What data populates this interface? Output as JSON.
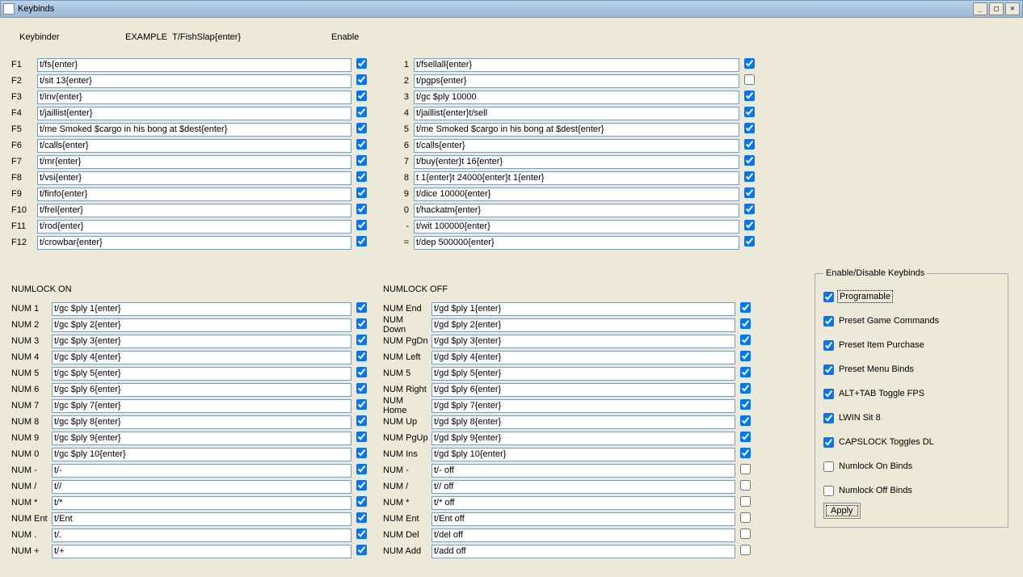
{
  "window": {
    "title": "Keybinds",
    "minimize": "_",
    "maximize": "□",
    "close": "✕"
  },
  "headers": {
    "keybinder": "Keybinder",
    "example_pre": "EXAMPLE",
    "example_txt": "T/FishSlap{enter}",
    "enable": "Enable"
  },
  "fkeys": [
    {
      "k": "F1",
      "v": "t/fs{enter}",
      "c": true
    },
    {
      "k": "F2",
      "v": "t/sit 13{enter}",
      "c": true
    },
    {
      "k": "F3",
      "v": "t/inv{enter}",
      "c": true
    },
    {
      "k": "F4",
      "v": "t/jaillist{enter}",
      "c": true
    },
    {
      "k": "F5",
      "v": "t/me Smoked $cargo in his bong at $dest{enter}",
      "c": true
    },
    {
      "k": "F6",
      "v": "t/calls{enter}",
      "c": true
    },
    {
      "k": "F7",
      "v": "t/mr{enter}",
      "c": true
    },
    {
      "k": "F8",
      "v": "t/vsi{enter}",
      "c": true
    },
    {
      "k": "F9",
      "v": "t/finfo{enter}",
      "c": true
    },
    {
      "k": "F10",
      "v": "t/frel{enter}",
      "c": true
    },
    {
      "k": "F11",
      "v": "t/rod{enter}",
      "c": true
    },
    {
      "k": "F12",
      "v": "t/crowbar{enter}",
      "c": true
    }
  ],
  "numkeys": [
    {
      "k": "1",
      "v": "t/fsellall{enter}",
      "c": true
    },
    {
      "k": "2",
      "v": "t/pgps{enter}",
      "c": false
    },
    {
      "k": "3",
      "v": "t/gc $ply 10000",
      "c": true
    },
    {
      "k": "4",
      "v": "t/jaillist{enter}t/sell",
      "c": true
    },
    {
      "k": "5",
      "v": "t/me Smoked $cargo in his bong at $dest{enter}",
      "c": true
    },
    {
      "k": "6",
      "v": "t/calls{enter}",
      "c": true
    },
    {
      "k": "7",
      "v": "t/buy{enter}t 16{enter}",
      "c": true
    },
    {
      "k": "8",
      "v": "t 1{enter}t 24000{enter}t 1{enter}",
      "c": true
    },
    {
      "k": "9",
      "v": "t/dice 10000{enter}",
      "c": true
    },
    {
      "k": "0",
      "v": "t/hackatm{enter}",
      "c": true
    },
    {
      "k": "-",
      "v": "t/wit 100000{enter}",
      "c": true
    },
    {
      "k": "=",
      "v": "t/dep 500000{enter}",
      "c": true
    }
  ],
  "numlock_on_title": "NUMLOCK ON",
  "numlock_off_title": "NUMLOCK OFF",
  "numlock_on": [
    {
      "k": "NUM 1",
      "v": "t/gc $ply 1{enter}",
      "c": true
    },
    {
      "k": "NUM 2",
      "v": "t/gc $ply 2{enter}",
      "c": true
    },
    {
      "k": "NUM 3",
      "v": "t/gc $ply 3{enter}",
      "c": true
    },
    {
      "k": "NUM 4",
      "v": "t/gc $ply 4{enter}",
      "c": true
    },
    {
      "k": "NUM 5",
      "v": "t/gc $ply 5{enter}",
      "c": true
    },
    {
      "k": "NUM 6",
      "v": "t/gc $ply 6{enter}",
      "c": true
    },
    {
      "k": "NUM 7",
      "v": "t/gc $ply 7{enter}",
      "c": true
    },
    {
      "k": "NUM 8",
      "v": "t/gc $ply 8{enter}",
      "c": true
    },
    {
      "k": "NUM 9",
      "v": "t/gc $ply 9{enter}",
      "c": true
    },
    {
      "k": "NUM 0",
      "v": "t/gc $ply 10{enter}",
      "c": true
    },
    {
      "k": "NUM -",
      "v": "t/-",
      "c": true
    },
    {
      "k": "NUM /",
      "v": "t//",
      "c": true
    },
    {
      "k": "NUM *",
      "v": "t/*",
      "c": true
    },
    {
      "k": "NUM Ent",
      "v": "t/Ent",
      "c": true
    },
    {
      "k": "NUM .",
      "v": "t/.",
      "c": true
    },
    {
      "k": "NUM +",
      "v": "t/+",
      "c": true
    }
  ],
  "numlock_off": [
    {
      "k": "NUM End",
      "v": "t/gd $ply 1{enter}",
      "c": true
    },
    {
      "k": "NUM Down",
      "v": "t/gd $ply 2{enter}",
      "c": true
    },
    {
      "k": "NUM PgDn",
      "v": "t/gd $ply 3{enter}",
      "c": true
    },
    {
      "k": "NUM Left",
      "v": "t/gd $ply 4{enter}",
      "c": true
    },
    {
      "k": "NUM 5",
      "v": "t/gd $ply 5{enter}",
      "c": true
    },
    {
      "k": "NUM Right",
      "v": "t/gd $ply 6{enter}",
      "c": true
    },
    {
      "k": "NUM Home",
      "v": "t/gd $ply 7{enter}",
      "c": true
    },
    {
      "k": "NUM Up",
      "v": "t/gd $ply 8{enter}",
      "c": true
    },
    {
      "k": "NUM PgUp",
      "v": "t/gd $ply 9{enter}",
      "c": true
    },
    {
      "k": "NUM Ins",
      "v": "t/gd $ply 10{enter}",
      "c": true
    },
    {
      "k": "NUM -",
      "v": "t/- off",
      "c": false
    },
    {
      "k": "NUM /",
      "v": "t// off",
      "c": false
    },
    {
      "k": "NUM *",
      "v": "t/* off",
      "c": false
    },
    {
      "k": "NUM Ent",
      "v": "t/Ent off",
      "c": false
    },
    {
      "k": "NUM Del",
      "v": "t/del off",
      "c": false
    },
    {
      "k": "NUM Add",
      "v": "t/add off",
      "c": false
    }
  ],
  "edgroup": {
    "legend": "Enable/Disable Keybinds",
    "items": [
      {
        "label": "Programable",
        "c": true,
        "focus": true
      },
      {
        "label": "Preset Game Commands",
        "c": true
      },
      {
        "label": "Preset Item Purchase",
        "c": true
      },
      {
        "label": "Preset Menu Binds",
        "c": true
      },
      {
        "label": "ALT+TAB Toggle FPS",
        "c": true
      },
      {
        "label": "LWIN Sit 8",
        "c": true
      },
      {
        "label": "CAPSLOCK Toggles DL",
        "c": true
      },
      {
        "label": "Numlock On Binds",
        "c": false
      },
      {
        "label": "Numlock Off Binds",
        "c": false
      }
    ],
    "apply": "Apply"
  }
}
